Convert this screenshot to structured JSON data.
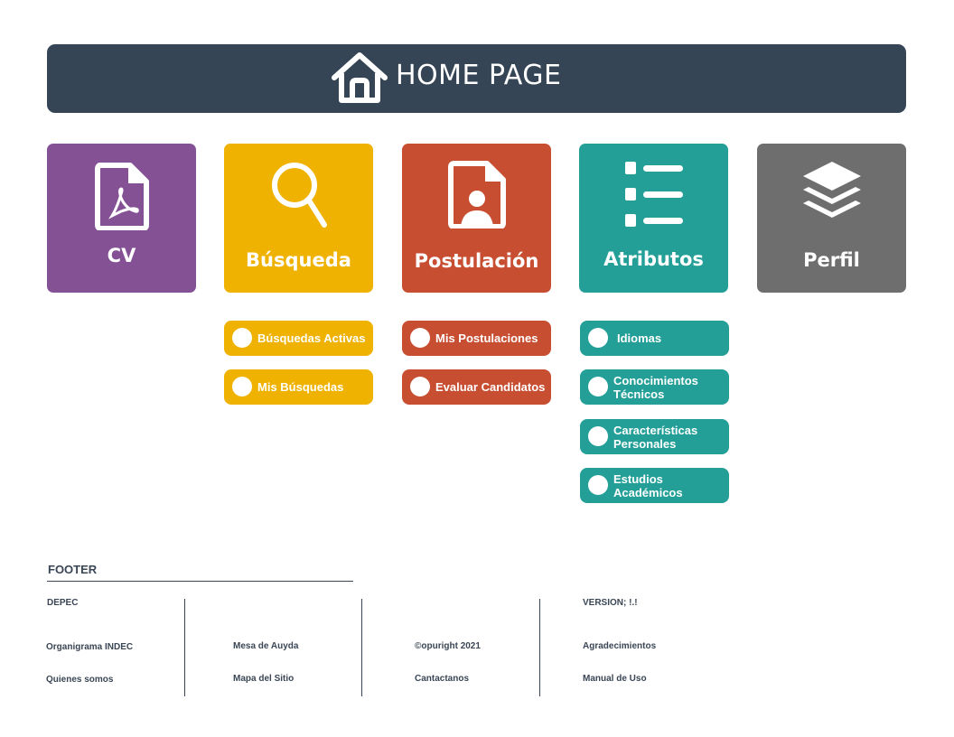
{
  "header": {
    "title": "HOME PAGE",
    "icon": "home-icon",
    "background": "#364556"
  },
  "tiles": [
    {
      "label": "CV",
      "icon": "pdf-file-icon",
      "color": "#845195"
    },
    {
      "label": "Búsqueda",
      "icon": "search-icon",
      "color": "#efb200"
    },
    {
      "label": "Postulación",
      "icon": "user-file-icon",
      "color": "#c84e32"
    },
    {
      "label": "Atributos",
      "icon": "list-icon",
      "color": "#239f98"
    },
    {
      "label": "Perfil",
      "icon": "layers-icon",
      "color": "#6e6e6e"
    }
  ],
  "busqueda_menu": [
    "Búsquedas Activas",
    "Mis Búsquedas"
  ],
  "postulacion_menu": [
    "Mis Postulaciones",
    "Evaluar Candidatos"
  ],
  "atributos_menu": [
    "Idiomas",
    "Conocimientos Técnicos",
    "Características Personales",
    "Estudios Académicos"
  ],
  "footer": {
    "title": "FOOTER",
    "col1": {
      "heading": "DEPEC",
      "links": [
        "Organigrama INDEC",
        "Quienes somos"
      ]
    },
    "col2": {
      "links": [
        "Mesa de Auyda",
        "Mapa del Sitio"
      ]
    },
    "col3": {
      "links": [
        "©opuright 2021",
        "Cantactanos"
      ]
    },
    "col4": {
      "heading": "VERSION; !.!",
      "links": [
        "Agradecimientos",
        "Manual de Uso"
      ]
    }
  }
}
